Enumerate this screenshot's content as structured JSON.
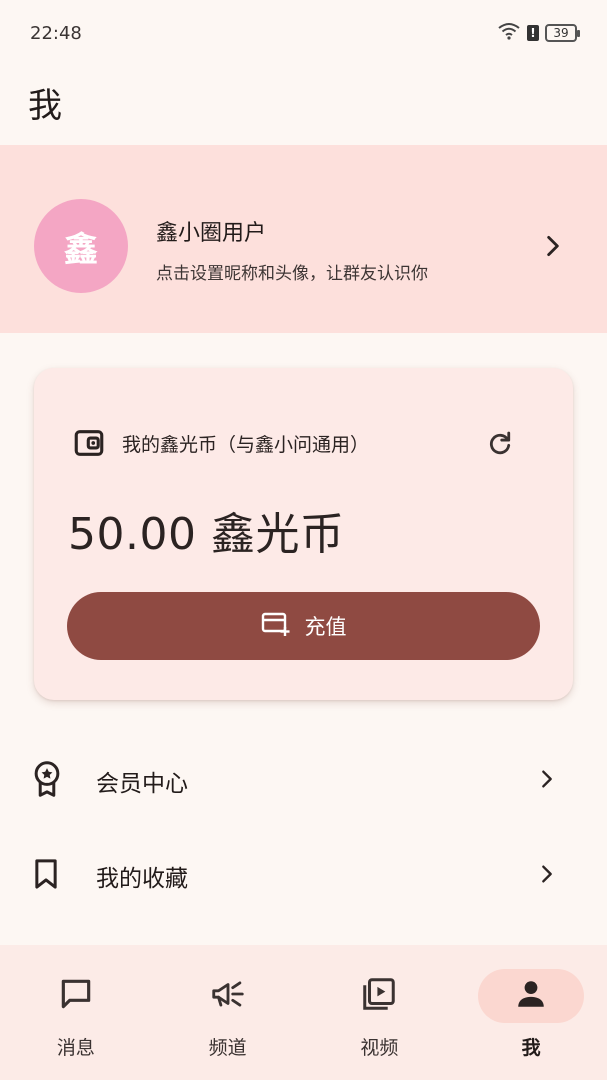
{
  "status_bar": {
    "time": "22:48",
    "battery": "39",
    "icons": [
      "wifi-icon",
      "alert-icon",
      "battery-icon"
    ]
  },
  "page": {
    "title": "我"
  },
  "profile": {
    "avatar_text": "鑫",
    "name": "鑫小圈用户",
    "hint": "点击设置昵称和头像，让群友认识你",
    "colors": {
      "banner": "#fde0dc",
      "avatar": "#f4a6c4"
    }
  },
  "wallet": {
    "title": "我的鑫光币（与鑫小问通用）",
    "balance": "50.00 鑫光币",
    "recharge_label": "充值",
    "colors": {
      "card": "#fdeae7",
      "button": "#8f4a42"
    }
  },
  "menu": {
    "items": [
      {
        "label": "会员中心",
        "icon": "badge-star-icon"
      },
      {
        "label": "我的收藏",
        "icon": "bookmark-icon"
      }
    ]
  },
  "bottom_nav": {
    "tabs": [
      {
        "label": "消息",
        "icon": "message-icon",
        "active": false
      },
      {
        "label": "频道",
        "icon": "megaphone-icon",
        "active": false
      },
      {
        "label": "视频",
        "icon": "video-library-icon",
        "active": false
      },
      {
        "label": "我",
        "icon": "person-icon",
        "active": true
      }
    ]
  }
}
